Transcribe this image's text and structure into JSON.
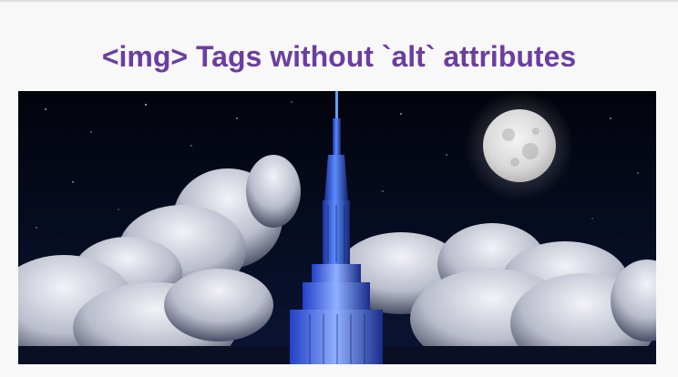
{
  "page": {
    "heading": "<img> Tags without `alt` attributes"
  },
  "image": {
    "colors": {
      "sky_top": "#02040c",
      "sky_bottom": "#0a1230",
      "moon": "#e8e8e8",
      "cloud": "#e4e6ee",
      "building_blue": "#3a6cf0",
      "building_dark": "#0d1a5a"
    }
  },
  "colors": {
    "heading": "#6a3ea1",
    "background": "#f8f8f8"
  }
}
